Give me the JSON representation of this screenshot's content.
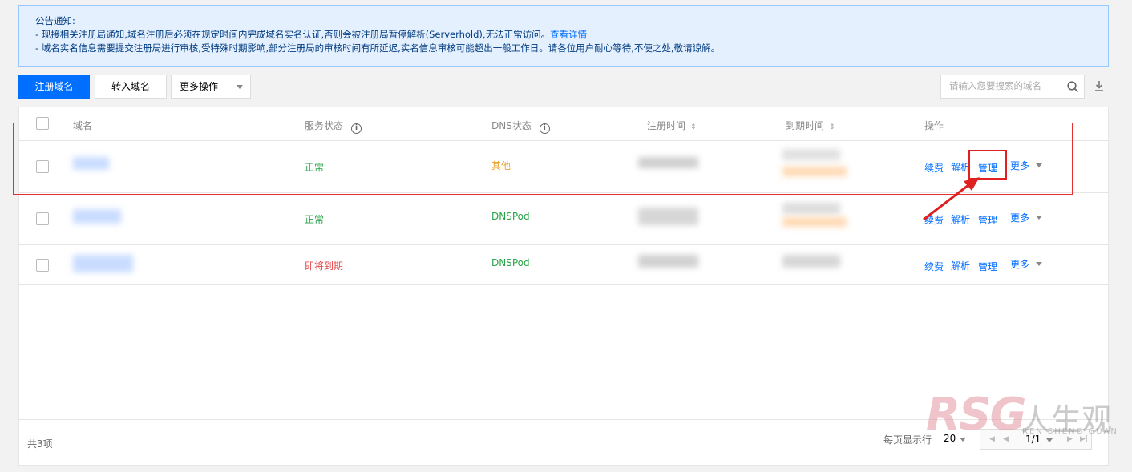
{
  "notice": {
    "title": "公告通知:",
    "line1": "- 现接相关注册局通知,域名注册后必须在规定时间内完成域名实名认证,否则会被注册局暂停解析(Serverhold),无法正常访问。",
    "line1_link": "查看详情",
    "line2": "- 域名实名信息需要提交注册局进行审核,受特殊时期影响,部分注册局的审核时间有所延迟,实名信息审核可能超出一般工作日。请各位用户耐心等待,不便之处,敬请谅解。"
  },
  "toolbar": {
    "register_label": "注册域名",
    "transfer_label": "转入域名",
    "more_ops_label": "更多操作",
    "search_placeholder": "请输入您要搜索的域名"
  },
  "table": {
    "headers": {
      "domain": "域名",
      "service_status": "服务状态",
      "dns_status": "DNS状态",
      "reg_time": "注册时间",
      "expire_time": "到期时间",
      "actions": "操作"
    },
    "rows": [
      {
        "service_status": "正常",
        "dns_status": "其他",
        "renew": "续费",
        "resolve": "解析",
        "manage": "管理",
        "more": "更多"
      },
      {
        "service_status": "正常",
        "dns_status": "DNSPod",
        "renew": "续费",
        "resolve": "解析",
        "manage": "管理",
        "more": "更多"
      },
      {
        "service_status": "即将到期",
        "dns_status": "DNSPod",
        "renew": "续费",
        "resolve": "解析",
        "manage": "管理",
        "more": "更多"
      }
    ]
  },
  "footer": {
    "total": "共3项",
    "per_page_label": "每页显示行",
    "per_page_value": "20",
    "page_value": "1/1"
  },
  "watermark": {
    "logo": "RSG",
    "cn": "人生观",
    "pinyin": "REN SHENG GUAN"
  },
  "colors": {
    "primary": "#006eff",
    "status_ok": "#29a347",
    "status_other": "#e8a02c",
    "status_expiring": "#e54545",
    "annotation": "#e02020"
  }
}
